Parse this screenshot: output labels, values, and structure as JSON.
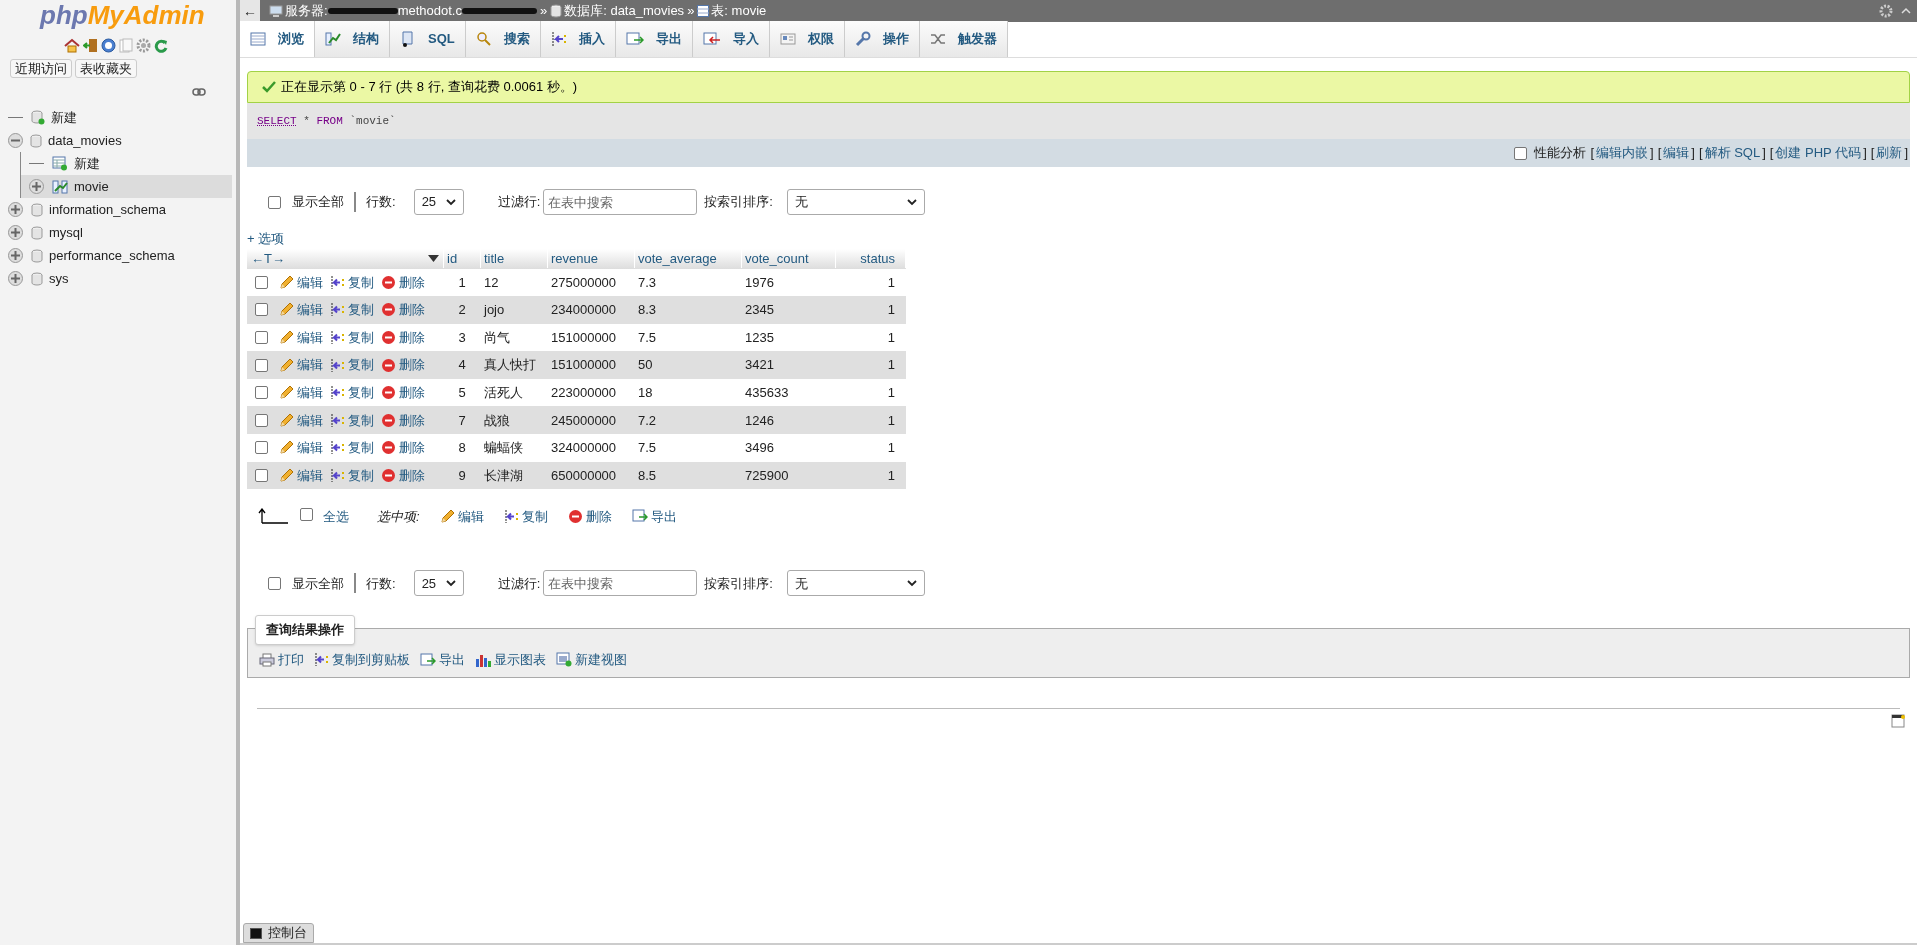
{
  "sidebar": {
    "logo": {
      "php": "php",
      "myadmin": "MyAdmin"
    },
    "buttons": [
      "近期访问",
      "表收藏夹"
    ],
    "tree": [
      {
        "label": "新建",
        "kind": "new",
        "expanded": false,
        "selected": false
      },
      {
        "label": "data_movies",
        "kind": "db",
        "expanded": true,
        "selected": false,
        "children": [
          {
            "label": "新建",
            "kind": "newtable",
            "expanded": false,
            "selected": false
          },
          {
            "label": "movie",
            "kind": "table",
            "expanded": false,
            "selected": true
          }
        ]
      },
      {
        "label": "information_schema",
        "kind": "db",
        "expanded": false,
        "selected": false
      },
      {
        "label": "mysql",
        "kind": "db",
        "expanded": false,
        "selected": false
      },
      {
        "label": "performance_schema",
        "kind": "db",
        "expanded": false,
        "selected": false
      },
      {
        "label": "sys",
        "kind": "db",
        "expanded": false,
        "selected": false
      }
    ]
  },
  "breadcrumb": {
    "back": "←",
    "server_label": "服务器:",
    "server_visible": "methodot.c",
    "sep": "»",
    "db": "数据库: data_movies",
    "table": "表: movie"
  },
  "tabs": [
    {
      "label": "浏览",
      "selected": true
    },
    {
      "label": "结构",
      "selected": false
    },
    {
      "label": "SQL",
      "selected": false
    },
    {
      "label": "搜索",
      "selected": false
    },
    {
      "label": "插入",
      "selected": false
    },
    {
      "label": "导出",
      "selected": false
    },
    {
      "label": "导入",
      "selected": false
    },
    {
      "label": "权限",
      "selected": false
    },
    {
      "label": "操作",
      "selected": false
    },
    {
      "label": "触发器",
      "selected": false
    }
  ],
  "message": "正在显示第 0 - 7 行 (共 8 行, 查询花费 0.0061 秒。)",
  "sql": {
    "keyword1": "SELECT",
    "rest": " * ",
    "keyword2": "FROM",
    "table": " `movie`"
  },
  "sql_links": {
    "profiling_label": "性能分析",
    "profiling_checked": false,
    "links": [
      {
        "open": "[",
        "label": "编辑内嵌",
        "close": "]"
      },
      {
        "open": "[",
        "label": "编辑",
        "close": "]"
      },
      {
        "open": "[",
        "label": "解析 SQL",
        "close": "]"
      },
      {
        "open": "[",
        "label": "创建 PHP 代码",
        "close": "]"
      },
      {
        "open": "[",
        "label": "刷新",
        "close": "]"
      }
    ]
  },
  "nav_top": {
    "show_all": "显示全部",
    "show_all_checked": false,
    "rows_label": "行数:",
    "rows_value": "25",
    "filter_label": "过滤行:",
    "filter_placeholder": "在表中搜索",
    "sort_label": "按索引排序:",
    "sort_value": "无"
  },
  "options_link": "+ 选项",
  "table": {
    "arrows": "←T→",
    "columns": [
      "id",
      "title",
      "revenue",
      "vote_average",
      "vote_count",
      "status"
    ],
    "rows": [
      {
        "checked": false,
        "actions": [
          "编辑",
          "复制",
          "删除"
        ],
        "cells": [
          "1",
          "12",
          "275000000",
          "7.3",
          "1976",
          "1"
        ]
      },
      {
        "checked": false,
        "actions": [
          "编辑",
          "复制",
          "删除"
        ],
        "cells": [
          "2",
          "jojo",
          "234000000",
          "8.3",
          "2345",
          "1"
        ]
      },
      {
        "checked": false,
        "actions": [
          "编辑",
          "复制",
          "删除"
        ],
        "cells": [
          "3",
          "尚气",
          "151000000",
          "7.5",
          "1235",
          "1"
        ]
      },
      {
        "checked": false,
        "actions": [
          "编辑",
          "复制",
          "删除"
        ],
        "cells": [
          "4",
          "真人快打",
          "151000000",
          "50",
          "3421",
          "1"
        ]
      },
      {
        "checked": false,
        "actions": [
          "编辑",
          "复制",
          "删除"
        ],
        "cells": [
          "5",
          "活死人",
          "223000000",
          "18",
          "435633",
          "1"
        ]
      },
      {
        "checked": false,
        "actions": [
          "编辑",
          "复制",
          "删除"
        ],
        "cells": [
          "7",
          "战狼",
          "245000000",
          "7.2",
          "1246",
          "1"
        ]
      },
      {
        "checked": false,
        "actions": [
          "编辑",
          "复制",
          "删除"
        ],
        "cells": [
          "8",
          "蝙蝠侠",
          "324000000",
          "7.5",
          "3496",
          "1"
        ]
      },
      {
        "checked": false,
        "actions": [
          "编辑",
          "复制",
          "删除"
        ],
        "cells": [
          "9",
          "长津湖",
          "650000000",
          "8.5",
          "725900",
          "1"
        ]
      }
    ]
  },
  "bulk": {
    "select_all": "全选",
    "select_all_checked": false,
    "with_selected": "选中项:",
    "actions": [
      "编辑",
      "复制",
      "删除",
      "导出"
    ]
  },
  "nav_bottom": {
    "show_all": "显示全部",
    "show_all_checked": false,
    "rows_label": "行数:",
    "rows_value": "25",
    "filter_label": "过滤行:",
    "filter_placeholder": "在表中搜索",
    "sort_label": "按索引排序:",
    "sort_value": "无"
  },
  "query_ops": {
    "legend": "查询结果操作",
    "actions": [
      "打印",
      "复制到剪贴板",
      "导出",
      "显示图表",
      "新建视图"
    ]
  },
  "console": "控制台"
}
